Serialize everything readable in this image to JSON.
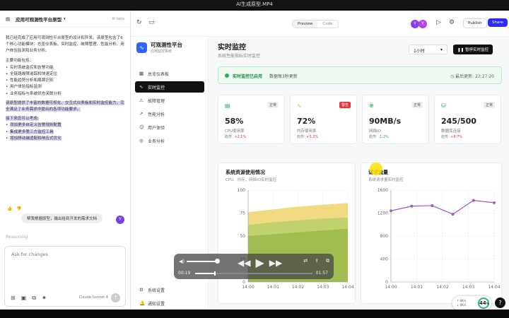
{
  "window": {
    "title": "AI生成原型.MP4"
  },
  "chat": {
    "project_title": "应用可观测性平台原型",
    "badge": "AI beta",
    "intro": "我已经完成了应用可观测性平台原型的设计和开发。该原型包含了6个核心功能模块：总览仪表板、实时监控、故障管理、性能分析、用户体验监测和业务分析。",
    "features_heading": "主要功能包括：",
    "features": [
      "实时系统监控和告警功能",
      "全链路故障追踪和快速定位",
      "性能趋势分析和瓶颈识别",
      "用户体验指标监测",
      "业务指标与系统状态关联分析"
    ],
    "summary": "该原型提供了丰富的数据可视化、交互式仪表板和实时监控能力，完全满足了业务需求中提出的各项功能要求。",
    "next_heading": "接下来您可以考虑:",
    "next_steps": [
      "添加更多自定义告警规则配置",
      "集成更多第三方监控工具",
      "增加移动端适配和响应式优化"
    ],
    "user_message": "帮我根据原型，输出给到开发的需求文档",
    "user_avatar": "Y",
    "reasoning_label": "Reasoning",
    "input_placeholder": "Ask for changes",
    "model_label": "Claude Sonnet 4"
  },
  "toolbar": {
    "preview_label": "Preview",
    "code_label": "Code",
    "avatar_1": "Y",
    "avatar_2": "Y",
    "publish_label": "Publish",
    "share_label": "Share"
  },
  "nav": {
    "brand_title": "可观测性平台",
    "brand_subtitle": "应用监控系统",
    "items": [
      {
        "label": "总览仪表板",
        "icon": "dashboard-icon"
      },
      {
        "label": "实时监控",
        "icon": "pulse-icon"
      },
      {
        "label": "故障管理",
        "icon": "warning-icon"
      },
      {
        "label": "性能分析",
        "icon": "trend-icon"
      },
      {
        "label": "用户体验",
        "icon": "users-icon"
      },
      {
        "label": "业务分析",
        "icon": "target-icon"
      }
    ],
    "bottom_items": [
      {
        "label": "系统设置",
        "icon": "gear-icon"
      },
      {
        "label": "通知设置",
        "icon": "bell-icon"
      }
    ]
  },
  "main": {
    "title": "实时监控",
    "subtitle": "系统性能指标实时监控",
    "time_select": "1小时",
    "pause_button": "暂停实时监控",
    "status": {
      "label": "实时监控已启用",
      "detail": "数据每3秒更新",
      "last_update": "最后更新: 23:27:20"
    },
    "cards": [
      {
        "value": "58%",
        "label": "CPU使用率",
        "tag": "正常",
        "change_prefix": "趋势: ",
        "change": "+2.1%",
        "warn": false,
        "up": true,
        "color": "#22b14c"
      },
      {
        "value": "72%",
        "label": "内存使用率",
        "tag": "警告",
        "change_prefix": "趋势: ",
        "change": "+5.3%",
        "warn": true,
        "up": true,
        "color": "#e8a317"
      },
      {
        "value": "90MB/s",
        "label": "网络IO",
        "tag": "正常",
        "change_prefix": "趋势: ",
        "change": "-1.2%",
        "warn": false,
        "up": false,
        "color": "#22b14c"
      },
      {
        "value": "245/500",
        "label": "数据库连接",
        "tag": "正常",
        "change_prefix": "趋势: ",
        "change": "+8.7%",
        "warn": false,
        "up": true,
        "color": "#22b14c"
      }
    ]
  },
  "player": {
    "current_time": "00:19",
    "duration": "01:57",
    "progress": 0.16,
    "volume": 0.9
  },
  "widget": {
    "percent": "44",
    "percent_unit": "%",
    "up_rate": "0K/s",
    "down_rate": "0K/s"
  },
  "chart_data": [
    {
      "type": "area",
      "title": "系统资源使用情况",
      "subtitle": "CPU、内存、网络IO实时监控",
      "x": [
        "14:00",
        "14:01",
        "14:02",
        "14:03",
        "14:04"
      ],
      "ylim": [
        0,
        100
      ],
      "yticks": [
        0,
        25,
        50,
        75,
        100
      ],
      "series": [
        {
          "values": [
            50,
            52,
            54,
            56,
            58
          ],
          "color": "#9bb84a"
        },
        {
          "values": [
            62,
            65,
            67,
            69,
            70
          ],
          "color": "#b7cf6a"
        },
        {
          "values": [
            76,
            79,
            82,
            84,
            86
          ],
          "color": "#f0d36a"
        }
      ],
      "grid": true
    },
    {
      "type": "line",
      "title": "请求流量",
      "subtitle": "系统请求量实时监控",
      "x": [
        "14:00",
        "14:01",
        "14:02",
        "14:03",
        "14:04"
      ],
      "ylim": [
        0,
        1600
      ],
      "yticks": [
        0,
        400,
        800,
        1200,
        1600
      ],
      "series": [
        {
          "values": [
            1240,
            1320,
            1330,
            1180,
            1420,
            1380
          ],
          "color": "#9b59d0"
        }
      ],
      "grid": true
    }
  ]
}
